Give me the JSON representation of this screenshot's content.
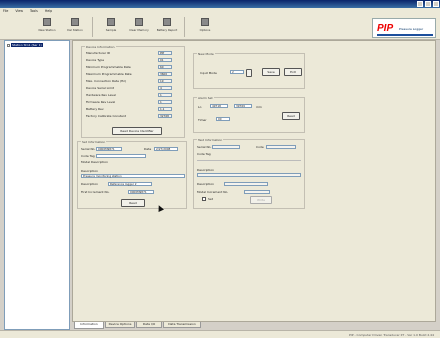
{
  "window": {
    "title": ""
  },
  "menu": [
    "File",
    "View",
    "Tools",
    "Help"
  ],
  "toolbar": {
    "buttons": [
      {
        "label": "New Station",
        "icon": "new-station-icon"
      },
      {
        "label": "Del Station",
        "icon": "delete-station-icon"
      },
      {
        "label": "Sample",
        "icon": "sample-icon"
      },
      {
        "label": "Clear Memory",
        "icon": "clear-memory-icon"
      },
      {
        "label": "Battery Report",
        "icon": "battery-report-icon"
      },
      {
        "label": "Options",
        "icon": "options-icon"
      }
    ]
  },
  "brand": {
    "logo": "PIP",
    "tagline": "Pressure Logger"
  },
  "tree": {
    "root": "Station Stn1 (Ser 1)"
  },
  "device_info": {
    "caption": "Device Information",
    "rows": [
      {
        "label": "Manufacturer ID",
        "value": "PIP"
      },
      {
        "label": "Device Type",
        "value": "01"
      },
      {
        "label": "Minimum Programmable Rate",
        "value": "60"
      },
      {
        "label": "Maximum Programmable Rate",
        "value": "3600"
      },
      {
        "label": "Max. Connection Rate (Hz)",
        "value": "19"
      },
      {
        "label": "Device Serial Limit",
        "value": "4"
      },
      {
        "label": "Hardware Rev Level",
        "value": "1"
      },
      {
        "label": "Firmware Rev Level",
        "value": "1"
      },
      {
        "label": "Battery Rev",
        "value": "1.1"
      },
      {
        "label": "Factory Calibrate Constant",
        "value": "32768"
      }
    ],
    "button": "Read Device Identifier"
  },
  "set_info": {
    "caption": "Set Information",
    "serial_label": "Serial No.",
    "serial_value": "0000M9871",
    "date_label": "Date",
    "date_value": "2/27/2008",
    "code_label": "Code Tag",
    "code_value": "",
    "model_label": "Model Description",
    "model_value": "",
    "description_label": "Description",
    "description_value": "Pressure monitoring station",
    "description_label2": "Description",
    "description_value2": "Reference logger 2",
    "first_increment_label": "First Increment No.",
    "first_increment_value": "0000M9871",
    "button": "Read"
  },
  "new_mode": {
    "caption": "New Mode",
    "label": "Input Mode",
    "value": "2",
    "set_button": "Save",
    "exit_button": "Exit"
  },
  "alarms": {
    "caption": "Alarm Set",
    "low_label": "Lo",
    "low_value": "49718",
    "high_value": "39769",
    "unit": "mm",
    "timer_label": "Timer",
    "timer_value": "00",
    "button": "Read"
  },
  "test_info": {
    "caption": "Test Information",
    "serial_label": "Serial No.",
    "code_label": "Code",
    "code_tag_label": "Code Tag",
    "description_label": "Description",
    "description_label2": "Description",
    "first_increment_label": "Model Increment No.",
    "check_label": "Set",
    "button": "Write"
  },
  "tabs": [
    "Information",
    "Device Options",
    "Data I/O",
    "Data Transmission"
  ],
  "status": {
    "text": "PIP - Computer Driven Transducer IIT - Ver 1.0 Build 2.44"
  }
}
